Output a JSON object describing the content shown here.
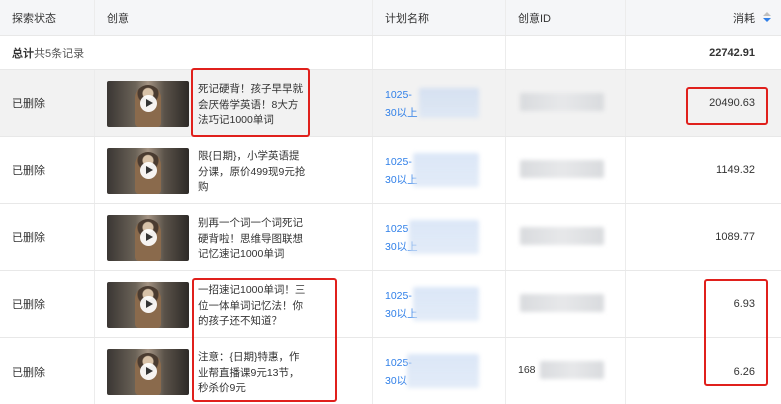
{
  "header": {
    "status": "探索状态",
    "creative": "创意",
    "plan": "计划名称",
    "creative_id": "创意ID",
    "cost": "消耗"
  },
  "total": {
    "label_strong": "总计",
    "label_normal": "共5条记录",
    "cost": "22742.91"
  },
  "rows": [
    {
      "status": "已删除",
      "desc": "死记硬背！孩子早早就\n会厌倦学英语！8大方\n法巧记1000单词",
      "plan_line1": "1025-",
      "plan_line2": "30以上",
      "creative_id": "",
      "cost": "20490.63"
    },
    {
      "status": "已删除",
      "desc": "限{日期}，小学英语提\n分课，原价499现9元抢\n购",
      "plan_line1": "1025-",
      "plan_line2": "30以上",
      "creative_id": "",
      "cost": "1149.32"
    },
    {
      "status": "已删除",
      "desc": "别再一个词一个词死记\n硬背啦！思维导图联想\n记忆速记1000单词",
      "plan_line1": "1025",
      "plan_line2": "30以上",
      "creative_id": "",
      "cost": "1089.77"
    },
    {
      "status": "已删除",
      "desc": "一招速记1000单词！三\n位一体单词记忆法！你\n的孩子还不知道？",
      "plan_line1": "1025-",
      "plan_line2": "30以上",
      "creative_id": "",
      "cost": "6.93"
    },
    {
      "status": "已删除",
      "desc": "注意：{日期}特惠，作\n业帮直播课9元13节，\n秒杀价9元",
      "plan_line1": "1025-",
      "plan_line2": "30以",
      "creative_id": "168",
      "cost": "6.26"
    }
  ],
  "icons": {
    "sort": "sort-caret-icon",
    "play": "play-icon"
  },
  "colors": {
    "link": "#2f7fe8",
    "highlight_box": "#e0201c",
    "header_bg": "#f5f6f8",
    "selected_row_bg": "#f2f2f2"
  }
}
